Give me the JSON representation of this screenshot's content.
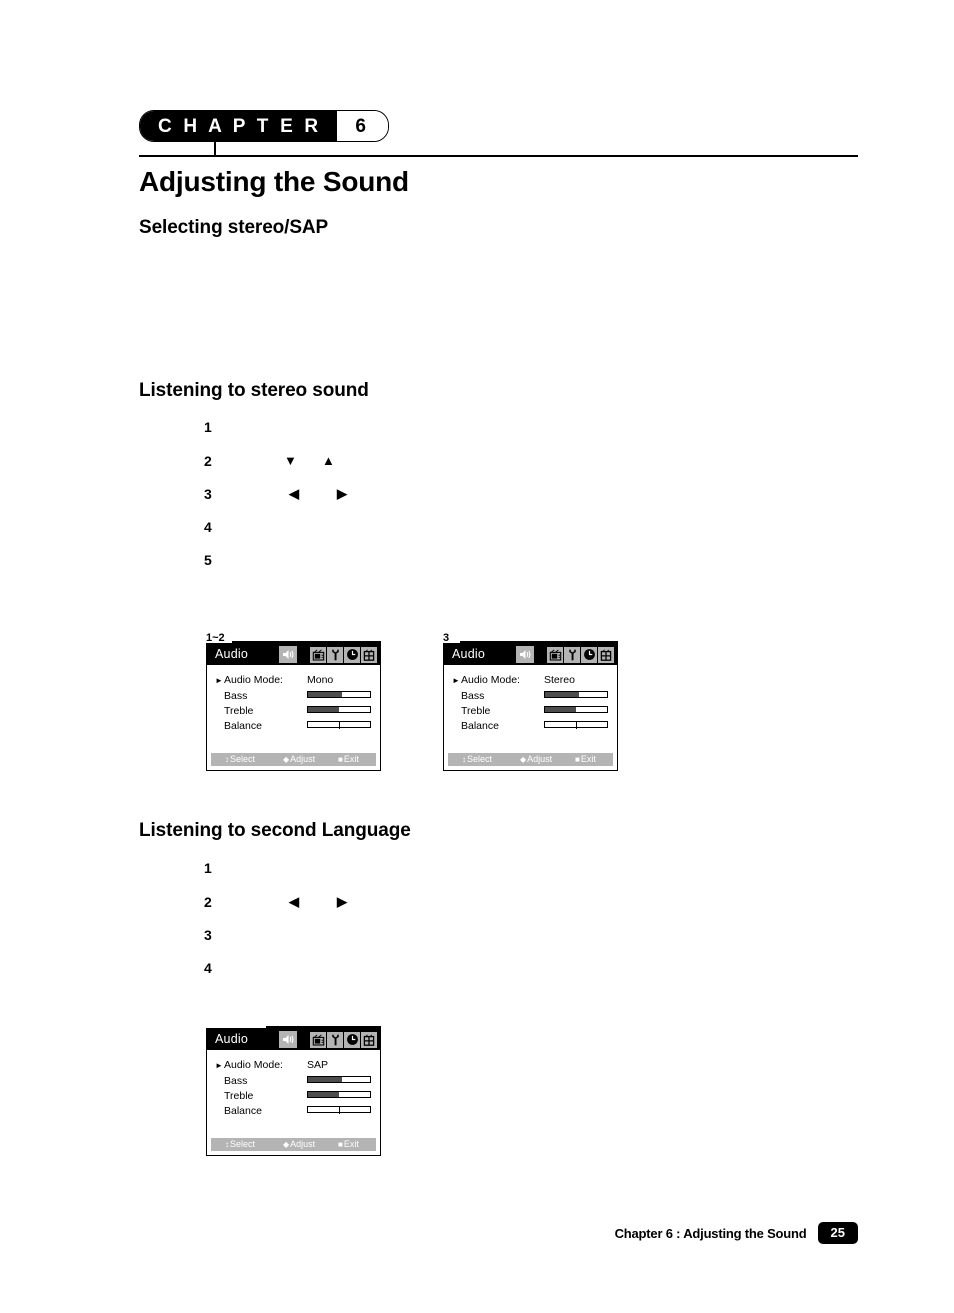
{
  "document": {
    "chapter_badge": {
      "word": "C H A P T E R",
      "number": "6"
    },
    "title": "Adjusting the Sound",
    "subtitle": "Selecting stereo/SAP"
  },
  "sections": [
    {
      "heading": "Listening to stereo sound",
      "steps": [
        {
          "number": "1",
          "glyphs": []
        },
        {
          "number": "2",
          "glyphs": [
            "▼",
            "▲"
          ]
        },
        {
          "number": "3",
          "glyphs": [
            "◀",
            "▶"
          ]
        },
        {
          "number": "4",
          "glyphs": []
        },
        {
          "number": "5",
          "glyphs": []
        }
      ]
    },
    {
      "heading": "Listening to second Language",
      "steps": [
        {
          "number": "1",
          "glyphs": []
        },
        {
          "number": "2",
          "glyphs": [
            "◀",
            "▶"
          ]
        },
        {
          "number": "3",
          "glyphs": []
        },
        {
          "number": "4",
          "glyphs": []
        }
      ]
    }
  ],
  "osd_common": {
    "title": "Audio",
    "speaker_icon": "speaker-volume-icon",
    "tab_icons": [
      "tv-icon",
      "wrench-setup-icon",
      "clock-timer-icon",
      "channel-grid-icon"
    ],
    "rows": {
      "audio_mode_label": "Audio Mode:",
      "bass_label": "Bass",
      "treble_label": "Treble",
      "balance_label": "Balance"
    },
    "footer": {
      "select_glyph": "↕",
      "select_label": "Select",
      "adjust_glyph": "◆",
      "adjust_label": "Adjust",
      "exit_glyph": "■",
      "exit_label": "Exit"
    },
    "colors": {
      "titlebar": "#000000",
      "tab_background": "#b4b4b4",
      "footer_background": "#b4b4b4",
      "slider_fill": "#4d4d4d",
      "body": "#ffffff"
    }
  },
  "figures": [
    {
      "label": "1~2",
      "audio_mode_value": "Mono",
      "bass_percent": 55,
      "treble_percent": 50,
      "balance_percent": 0,
      "balance_mark_percent": 50
    },
    {
      "label": "3",
      "audio_mode_value": "Stereo",
      "bass_percent": 55,
      "treble_percent": 50,
      "balance_percent": 0,
      "balance_mark_percent": 50
    },
    {
      "label": "",
      "audio_mode_value": "SAP",
      "bass_percent": 55,
      "treble_percent": 50,
      "balance_percent": 0,
      "balance_mark_percent": 50
    }
  ],
  "page_footer": {
    "text": "Chapter 6 : Adjusting the Sound",
    "page_number": "25"
  }
}
